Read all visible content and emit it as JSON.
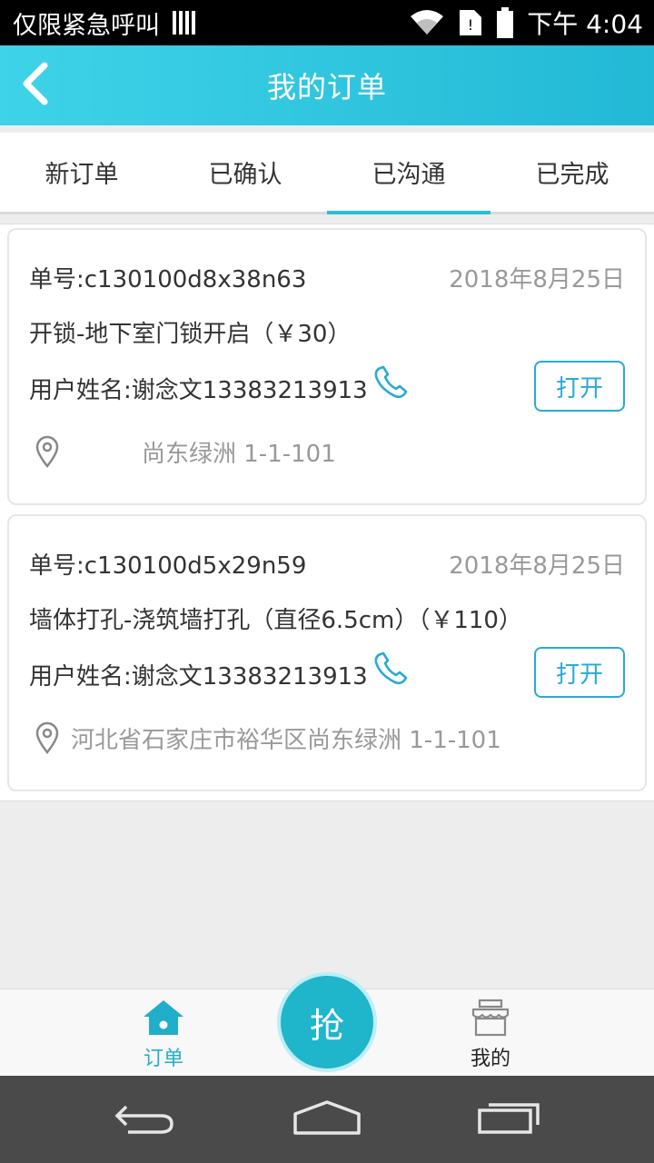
{
  "status_bar": {
    "carrier": "仅限紧急呼叫",
    "time": "下午 4:04",
    "icons": [
      "sim-bars-icon",
      "wifi-icon",
      "sim-card-icon",
      "battery-icon"
    ]
  },
  "header": {
    "title": "我的订单",
    "back_icon": "chevron-left-icon"
  },
  "tabs": [
    {
      "label": "新订单",
      "active": false
    },
    {
      "label": "已确认",
      "active": false
    },
    {
      "label": "已沟通",
      "active": true
    },
    {
      "label": "已完成",
      "active": false
    }
  ],
  "orders": [
    {
      "order_no": "单号:c130100d8x38n63",
      "date": "2018年8月25日",
      "service": "开锁-地下室门锁开启（￥30）",
      "user": "用户姓名:谢念文13383213913",
      "open_label": "打开",
      "address": "尚东绿洲 1-1-101"
    },
    {
      "order_no": "单号:c130100d5x29n59",
      "date": "2018年8月25日",
      "service": "墙体打孔-浇筑墙打孔（直径6.5cm）（￥110）",
      "user": "用户姓名:谢念文13383213913",
      "open_label": "打开",
      "address": "河北省石家庄市裕华区尚东绿洲 1-1-101"
    }
  ],
  "bottom_nav": {
    "orders_label": "订单",
    "grab_label": "抢",
    "mine_label": "我的"
  },
  "colors": {
    "accent": "#29bfd9",
    "header_start": "#3fd3e8",
    "header_end": "#22b9d6",
    "button_border": "#29a9d6",
    "nav_active": "#20aecb"
  }
}
